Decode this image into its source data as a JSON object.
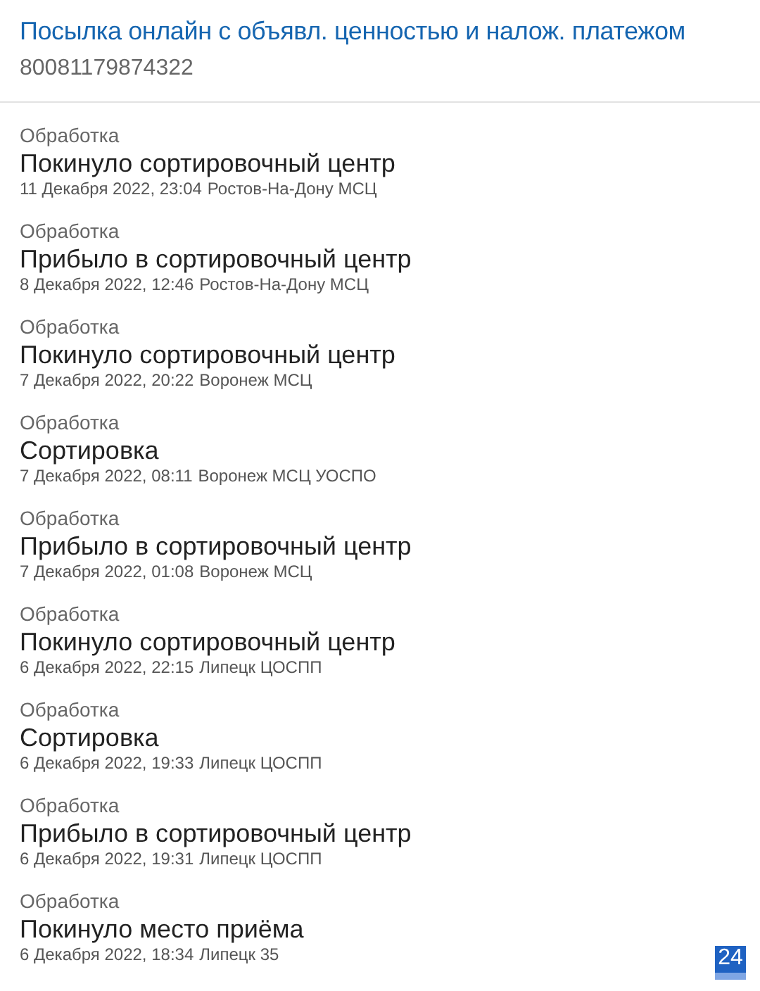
{
  "header": {
    "title": "Посылка онлайн с объявл. ценностью и налож. платежом",
    "tracking_number": "80081179874322"
  },
  "events": [
    {
      "category": "Обработка",
      "status": "Покинуло сортировочный центр",
      "date": "11 Декабря 2022, 23:04",
      "place": "Ростов-На-Дону МСЦ"
    },
    {
      "category": "Обработка",
      "status": "Прибыло в сортировочный центр",
      "date": "8 Декабря 2022, 12:46",
      "place": "Ростов-На-Дону МСЦ"
    },
    {
      "category": "Обработка",
      "status": "Покинуло сортировочный центр",
      "date": "7 Декабря 2022, 20:22",
      "place": "Воронеж МСЦ"
    },
    {
      "category": "Обработка",
      "status": "Сортировка",
      "date": "7 Декабря 2022, 08:11",
      "place": "Воронеж МСЦ УОСПО"
    },
    {
      "category": "Обработка",
      "status": "Прибыло в сортировочный центр",
      "date": "7 Декабря 2022, 01:08",
      "place": "Воронеж МСЦ"
    },
    {
      "category": "Обработка",
      "status": "Покинуло сортировочный центр",
      "date": "6 Декабря 2022, 22:15",
      "place": "Липецк ЦОСПП"
    },
    {
      "category": "Обработка",
      "status": "Сортировка",
      "date": "6 Декабря 2022, 19:33",
      "place": "Липецк ЦОСПП"
    },
    {
      "category": "Обработка",
      "status": "Прибыло в сортировочный центр",
      "date": "6 Декабря 2022, 19:31",
      "place": "Липецк ЦОСПП"
    },
    {
      "category": "Обработка",
      "status": "Покинуло место приёма",
      "date": "6 Декабря 2022, 18:34",
      "place": "Липецк 35"
    }
  ],
  "badge": "24"
}
